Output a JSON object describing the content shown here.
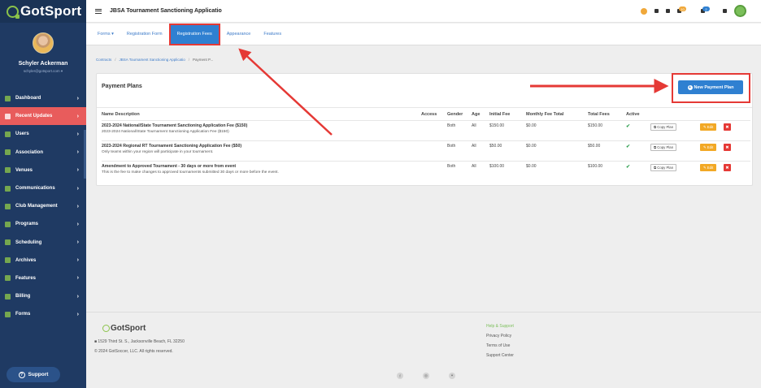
{
  "app": {
    "logo_text": "GotSport",
    "window_title": "JBSA Tournament Sanctioning Applicatio"
  },
  "profile": {
    "name": "Schyler Ackerman",
    "email": "schyler@gotsport.com ▾"
  },
  "sidebar": {
    "items": [
      {
        "label": "Dashboard",
        "icon": "dashboard-icon"
      },
      {
        "label": "Recent Updates",
        "icon": "updates-icon",
        "active": true
      },
      {
        "label": "Users",
        "icon": "users-icon"
      },
      {
        "label": "Association",
        "icon": "association-icon"
      },
      {
        "label": "Venues",
        "icon": "venues-icon"
      },
      {
        "label": "Communications",
        "icon": "communications-icon"
      },
      {
        "label": "Club Management",
        "icon": "club-icon"
      },
      {
        "label": "Programs",
        "icon": "programs-icon"
      },
      {
        "label": "Scheduling",
        "icon": "scheduling-icon"
      },
      {
        "label": "Archives",
        "icon": "archives-icon"
      },
      {
        "label": "Features",
        "icon": "features-icon"
      },
      {
        "label": "Billing",
        "icon": "billing-icon"
      },
      {
        "label": "Forms",
        "icon": "forms-icon"
      }
    ],
    "support_label": "Support"
  },
  "topbar": {
    "notification_count": "10",
    "chat_count": "2"
  },
  "tabs": [
    {
      "label": "Forms ▾"
    },
    {
      "label": "Registration Form"
    },
    {
      "label": "Registration Fees",
      "active": true
    },
    {
      "label": "Appearance"
    },
    {
      "label": "Features"
    }
  ],
  "breadcrumb": {
    "items": [
      "Contracts",
      "JBSA Tournament Sanctioning Applicatio",
      "Payment P..."
    ]
  },
  "payment_plans": {
    "title": "Payment Plans",
    "new_button_label": "New Payment Plan",
    "columns": [
      "Name Description",
      "Access",
      "Gender",
      "Age",
      "Initial Fee",
      "Monthly Fee Total",
      "Total Fees",
      "Active",
      "",
      "",
      ""
    ],
    "rows": [
      {
        "name": "2023-2024 National/State Tournament Sanctioning Application Fee ($150)",
        "description": "2023-2024 National/State Tournament Sanctioning Application Fee ($150)",
        "access": "",
        "gender": "Both",
        "age": "All",
        "initial_fee": "$150.00",
        "monthly_fee_total": "$0.00",
        "total_fees": "$150.00",
        "active": "✔"
      },
      {
        "name": "2023-2024 Regional RT Tournament Sanctioning Application Fee ($50)",
        "description": "Only teams within your region will participate in your tournament.",
        "access": "",
        "gender": "Both",
        "age": "All",
        "initial_fee": "$50.00",
        "monthly_fee_total": "$0.00",
        "total_fees": "$50.00",
        "active": "✔"
      },
      {
        "name": "Amendment to Approved Tournament - 30 days or more from event",
        "description": "This is the fee to make changes to approved tournaments submitted 30 days or more before the event.",
        "access": "",
        "gender": "Both",
        "age": "All",
        "initial_fee": "$100.00",
        "monthly_fee_total": "$0.00",
        "total_fees": "$100.00",
        "active": "✔"
      }
    ],
    "copy_label": "Copy Plan",
    "edit_label": "Edit"
  },
  "footer": {
    "logo_text": "GotSport",
    "address": "■ 1529 Third St. S., Jacksonville Beach, FL 32250",
    "copyright": "© 2024 GotSoccer, LLC. All rights reserved.",
    "links": [
      "Help & Support",
      "Privacy Policy",
      "Terms of Use",
      "Support Center"
    ],
    "social": [
      "f",
      "◎",
      "✶"
    ]
  },
  "colors": {
    "sidebar_bg": "#1f3a63",
    "active_nav": "#e85c5c",
    "primary_blue": "#2f80d1",
    "annotation_red": "#e53935",
    "edit_orange": "#f2a825"
  }
}
